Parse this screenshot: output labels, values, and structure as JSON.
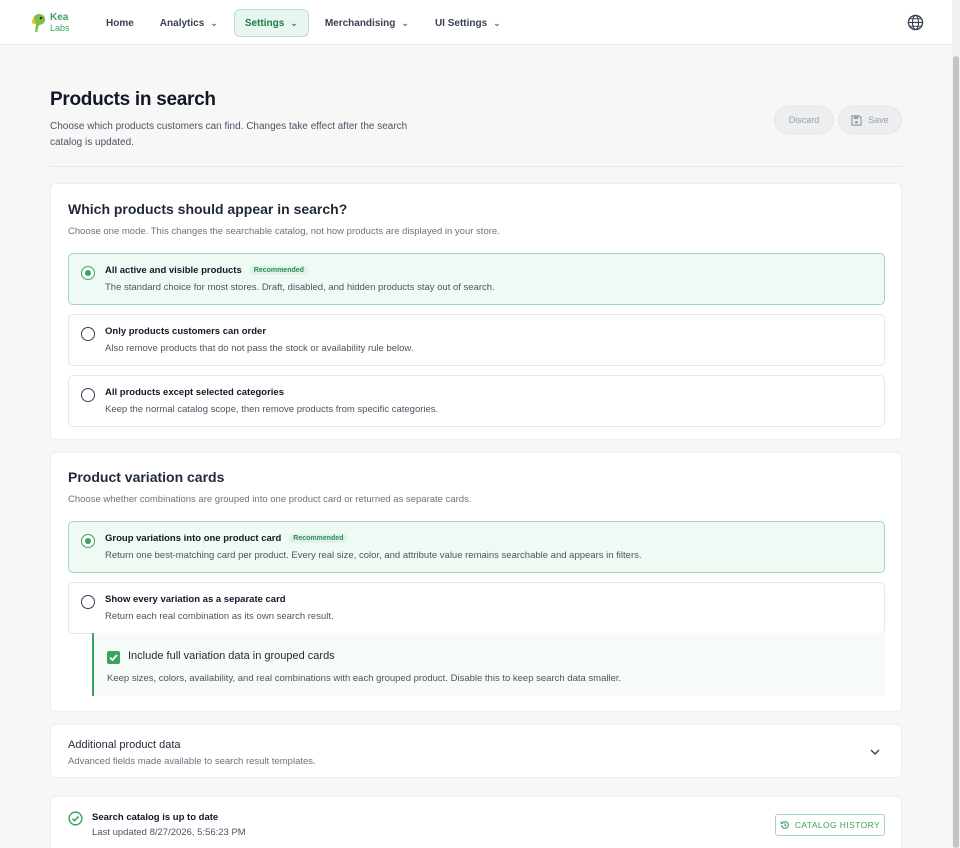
{
  "app": {
    "logo_line1": "Kea",
    "logo_line2": "Labs"
  },
  "nav": [
    {
      "label": "Home",
      "dropdown": false,
      "active": false
    },
    {
      "label": "Analytics",
      "dropdown": true,
      "active": false
    },
    {
      "label": "Settings",
      "dropdown": true,
      "active": true
    },
    {
      "label": "Merchandising",
      "dropdown": true,
      "active": false
    },
    {
      "label": "UI Settings",
      "dropdown": true,
      "active": false
    }
  ],
  "header": {
    "title": "Products in search",
    "description": "Choose which products customers can find. Changes take effect after the search catalog is updated.",
    "discard_label": "Discard",
    "save_label": "Save"
  },
  "search_scope": {
    "title": "Which products should appear in search?",
    "description": "Choose one mode. This changes the searchable catalog, not how products are displayed in your store.",
    "options": [
      {
        "label": "All active and visible products",
        "badge": "Recommended",
        "description": "The standard choice for most stores. Draft, disabled, and hidden products stay out of search.",
        "selected": true
      },
      {
        "label": "Only products customers can order",
        "badge": "",
        "description": "Also remove products that do not pass the stock or availability rule below.",
        "selected": false
      },
      {
        "label": "All products except selected categories",
        "badge": "",
        "description": "Keep the normal catalog scope, then remove products from specific categories.",
        "selected": false
      }
    ]
  },
  "variation_cards": {
    "title": "Product variation cards",
    "description": "Choose whether combinations are grouped into one product card or returned as separate cards.",
    "options": [
      {
        "label": "Group variations into one product card",
        "badge": "Recommended",
        "description": "Return one best-matching card per product. Every real size, color, and attribute value remains searchable and appears in filters.",
        "selected": true
      },
      {
        "label": "Show every variation as a separate card",
        "badge": "",
        "description": "Return each real combination as its own search result.",
        "selected": false
      }
    ],
    "include_full_data": {
      "label": "Include full variation data in grouped cards",
      "description": "Keep sizes, colors, availability, and real combinations with each grouped product. Disable this to keep search data smaller.",
      "checked": true
    }
  },
  "additional_data": {
    "title": "Additional product data",
    "description": "Advanced fields made available to search result templates."
  },
  "catalog_status": {
    "title": "Search catalog is up to date",
    "last_updated": "Last updated 8/27/2026, 5:56:23 PM",
    "history_label": "CATALOG HISTORY"
  },
  "colors": {
    "accent": "#3aa35f",
    "accent_bg": "#eefaf3"
  }
}
